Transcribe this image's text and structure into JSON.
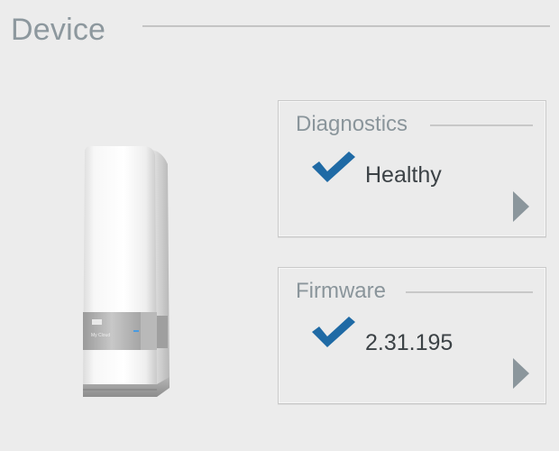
{
  "section": {
    "title": "Device"
  },
  "device_image": {
    "icon": "wd-my-cloud-device",
    "brand_mark": "WD",
    "model_text": "My Cloud",
    "led_color": "#4a9be0"
  },
  "cards": {
    "diagnostics": {
      "title": "Diagnostics",
      "value": "Healthy",
      "status_icon": "checkmark-icon",
      "nav_icon": "arrow-right-icon"
    },
    "firmware": {
      "title": "Firmware",
      "value": "2.31.195",
      "status_icon": "checkmark-icon",
      "nav_icon": "arrow-right-icon"
    }
  },
  "colors": {
    "check": "#1f6aa5",
    "arrow": "#8b969c",
    "title": "#8d989e",
    "value": "#3c4246"
  }
}
